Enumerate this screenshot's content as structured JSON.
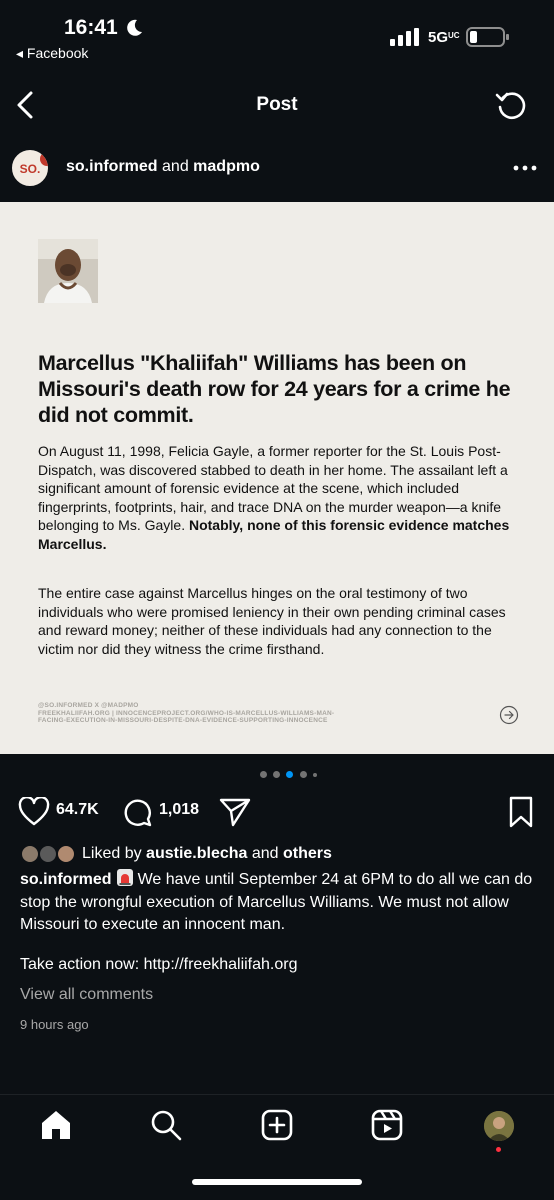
{
  "status_bar": {
    "time": "16:41",
    "back_app": "◂ Facebook",
    "network": "5G",
    "network_suffix": "UC"
  },
  "header": {
    "title": "Post"
  },
  "author": {
    "primary": "so.informed",
    "joiner": "and",
    "secondary": "madpmo",
    "avatar_text": "SO."
  },
  "card": {
    "headline": "Marcellus \"Khaliifah\" Williams has been on Missouri's death row for 24 years for a crime he did not commit.",
    "para1": "On August 11, 1998, Felicia Gayle, a former reporter for the St. Louis Post-Dispatch, was discovered stabbed to death in her home. The assailant left a significant amount of forensic evidence at the scene, which included fingerprints, footprints, hair, and trace DNA on the murder weapon—a knife belonging to Ms. Gayle.",
    "para1_bold": "Notably, none of this forensic evidence matches Marcellus.",
    "para2": "The entire case against Marcellus hinges on the oral testimony of two individuals who were promised leniency in their own pending criminal cases and reward money; neither of these individuals had any connection to the victim nor did they witness the crime firsthand.",
    "credit1": "@SO.INFORMED X @MADPMO",
    "credit2": "FREEKHALIIFAH.ORG | INNOCENCEPROJECT.ORG/WHO-IS-MARCELLUS-WILLIAMS-MAN-",
    "credit3": "FACING-EXECUTION-IN-MISSOURI-DESPITE-DNA-EVIDENCE-SUPPORTING-INNOCENCE"
  },
  "carousel": {
    "slide_count": 5,
    "active_index": 2
  },
  "actions": {
    "likes": "64.7K",
    "comments": "1,018"
  },
  "liked_by": {
    "prefix": "Liked by",
    "user": "austie.blecha",
    "joiner": "and",
    "others": "others"
  },
  "caption": {
    "user": "so.informed",
    "text": "We have until September 24 at 6PM to do all we can do stop the wrongful execution of Marcellus Williams. We must not allow Missouri to execute an innocent man.",
    "cta": "Take action now: http://freekhaliifah.org"
  },
  "view_comments": "View all comments",
  "time_ago": "9 hours ago",
  "colors": {
    "background": "#0c1014",
    "card": "#efede8",
    "active_dot": "#0095f6",
    "notification": "#ff3040"
  },
  "icons": [
    "moon-icon",
    "signal-icon",
    "battery-icon",
    "back-chevron-icon",
    "refresh-icon",
    "more-icon",
    "heart-icon",
    "comment-icon",
    "share-icon",
    "bookmark-icon",
    "arrow-right-circle-icon",
    "home-icon",
    "search-icon",
    "create-icon",
    "reels-icon"
  ]
}
